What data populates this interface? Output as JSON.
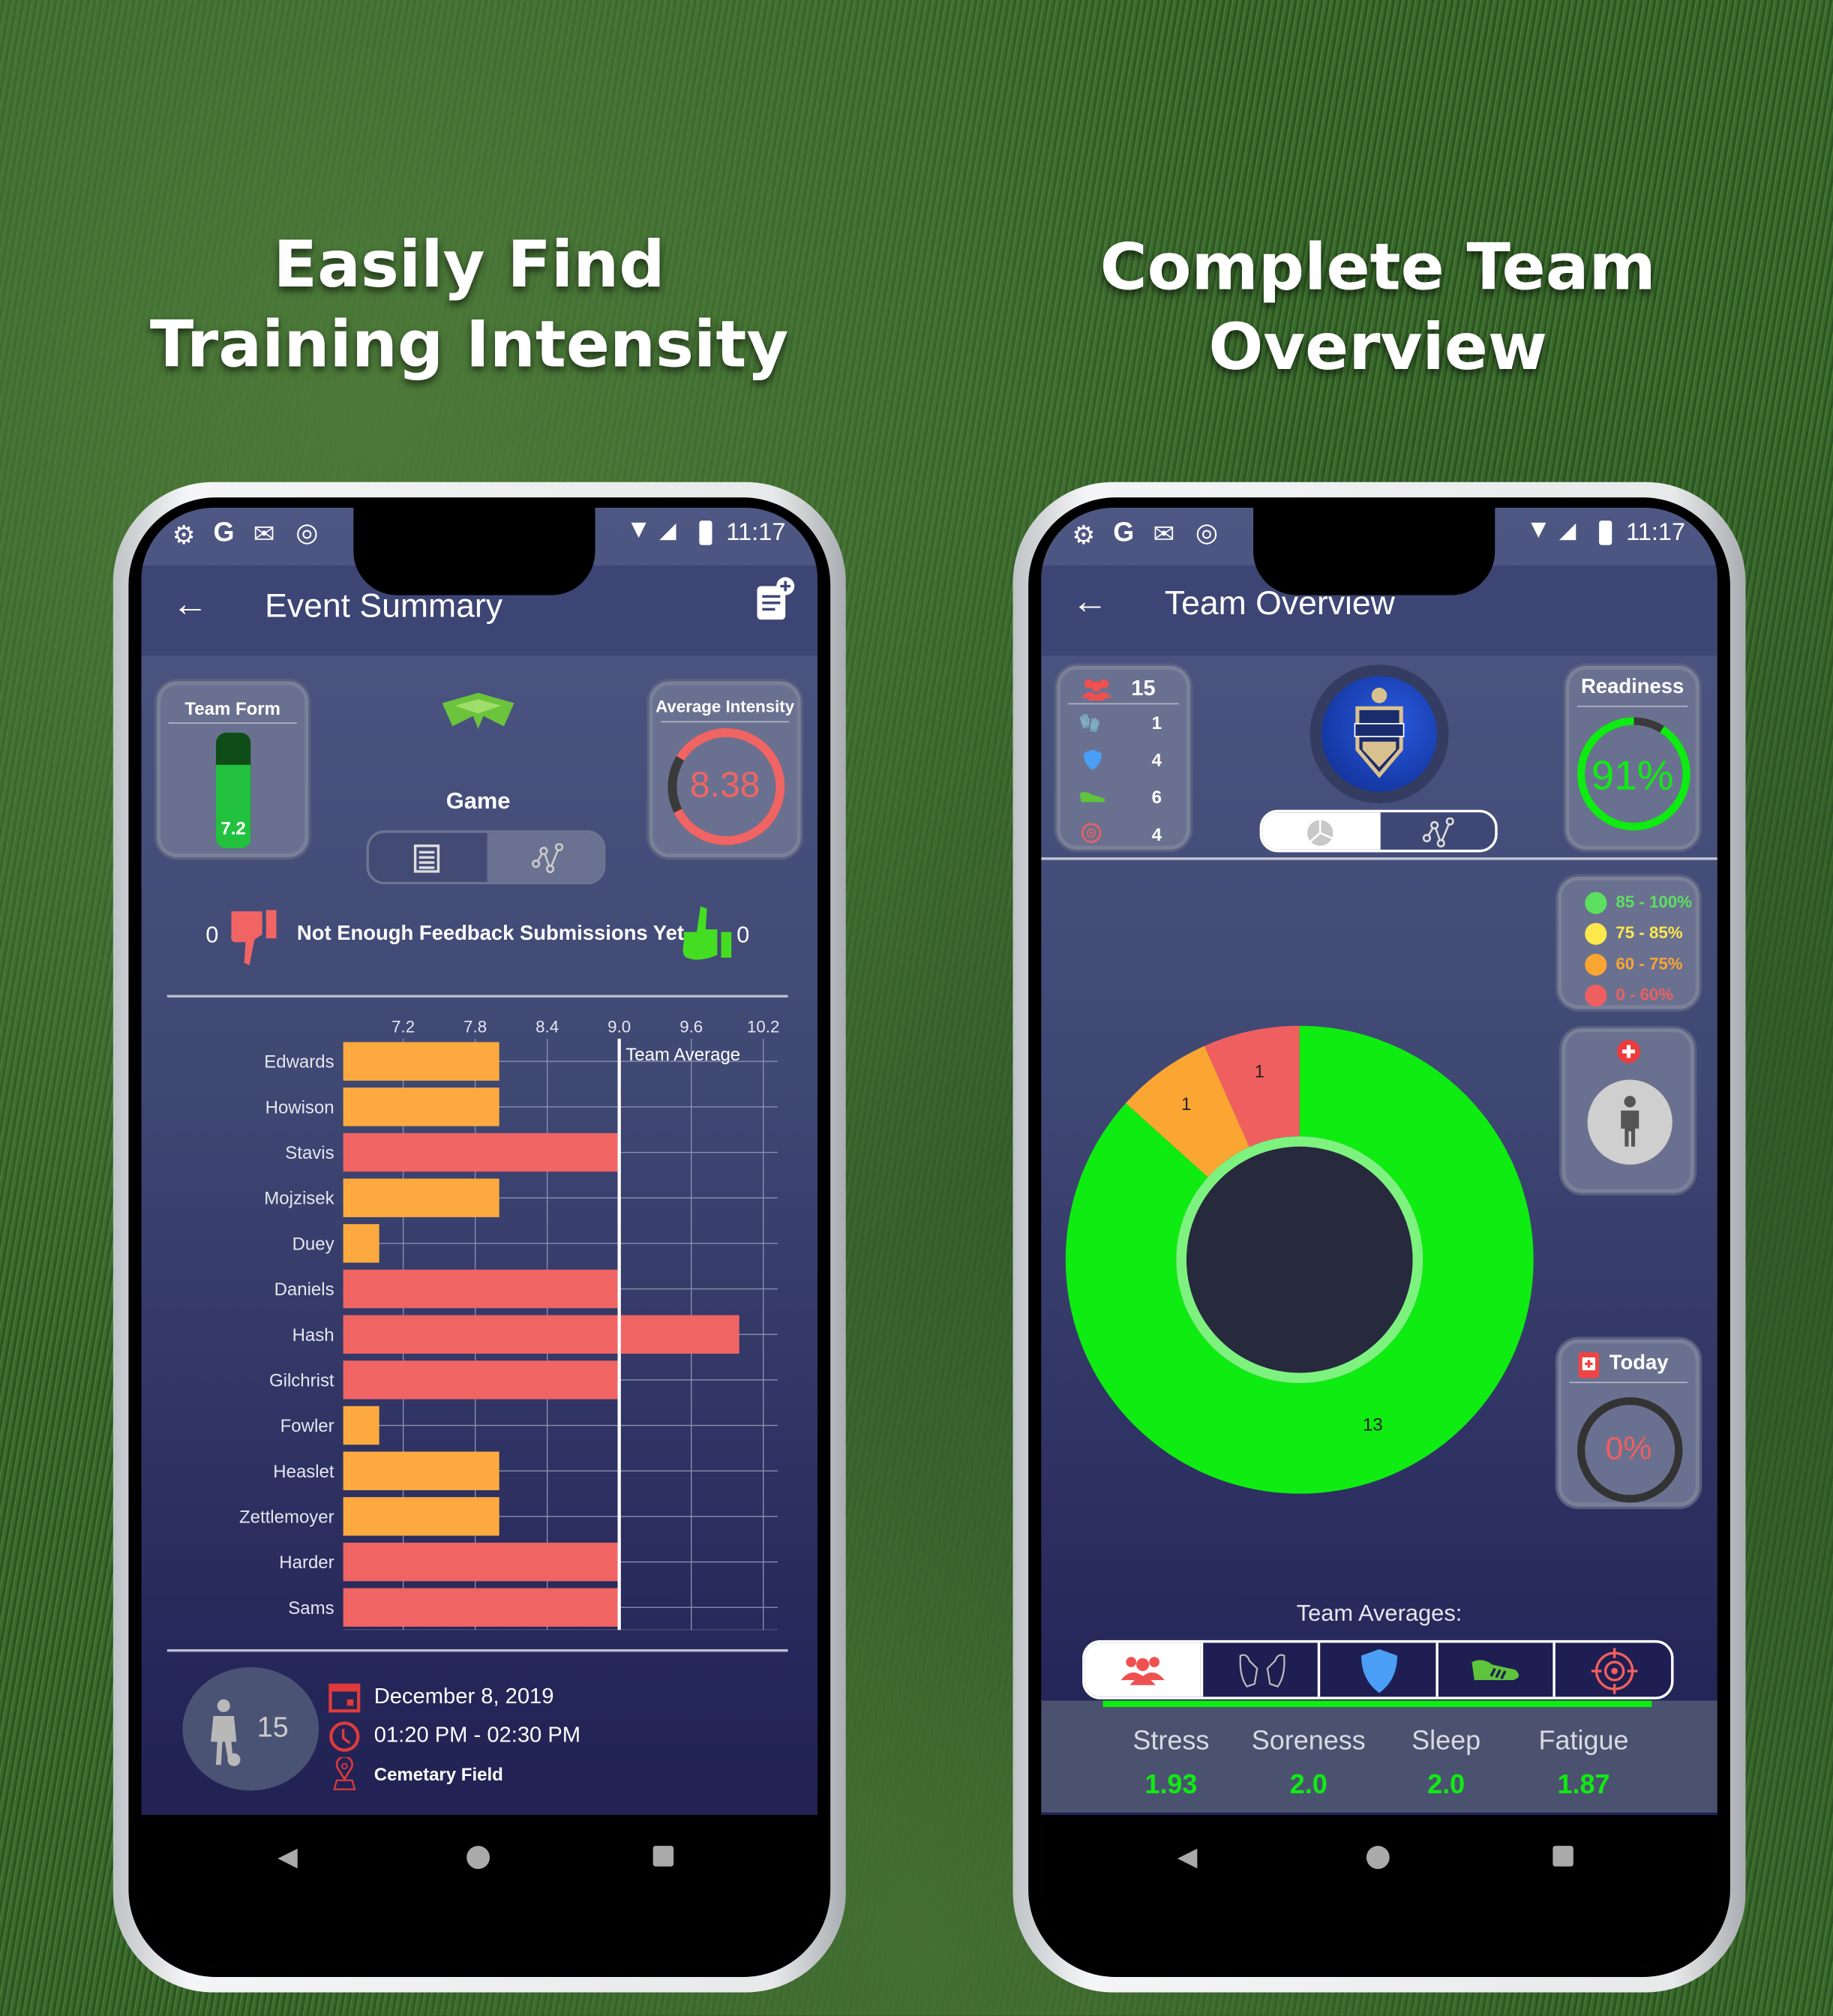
{
  "headlines": {
    "left": [
      "Easily Find",
      "Training Intensity"
    ],
    "right": [
      "Complete Team",
      "Overview"
    ]
  },
  "status": {
    "time": "11:17"
  },
  "event_summary": {
    "title": "Event Summary",
    "team_form": {
      "label": "Team Form",
      "value": "7.2",
      "fill_fraction": 0.72
    },
    "event_type": "Game",
    "average_intensity": {
      "label": "Average Intensity",
      "value": "8.38",
      "fill_fraction": 0.838
    },
    "feedback": {
      "thumbs_down": "0",
      "message": "Not Enough Feedback Submissions Yet",
      "thumbs_up": "0"
    },
    "players_count": "15",
    "date": "December 8, 2019",
    "time": "01:20 PM - 02:30 PM",
    "location": "Cemetary Field",
    "colors": {
      "orange": "#fcaa3f",
      "red": "#f06464",
      "green": "#22c23f"
    }
  },
  "chart_data": {
    "type": "bar",
    "orientation": "horizontal",
    "categories": [
      "Edwards",
      "Howison",
      "Stavis",
      "Mojzisek",
      "Duey",
      "Daniels",
      "Hash",
      "Gilchrist",
      "Fowler",
      "Heaslet",
      "Zettlemoyer",
      "Harder",
      "Sams"
    ],
    "values": [
      8,
      8,
      9,
      8,
      7,
      9,
      10,
      9,
      7,
      8,
      8,
      9,
      9
    ],
    "colors": [
      "#fcaa3f",
      "#fcaa3f",
      "#f06464",
      "#fcaa3f",
      "#fcaa3f",
      "#f06464",
      "#f06464",
      "#f06464",
      "#fcaa3f",
      "#fcaa3f",
      "#fcaa3f",
      "#f06464",
      "#f06464"
    ],
    "xticks": [
      "7.2",
      "7.8",
      "8.4",
      "9.0",
      "9.6",
      "10.2"
    ],
    "xlim": [
      6.7,
      10.32
    ],
    "reference_line": {
      "label": "Team Average",
      "value": 9.0
    },
    "grid": true
  },
  "team_overview": {
    "title": "Team Overview",
    "roster": {
      "total": "15",
      "rows": [
        {
          "icon": "goalkeeper-gloves-icon",
          "count": "1"
        },
        {
          "icon": "shield-icon",
          "count": "4"
        },
        {
          "icon": "cleat-icon",
          "count": "6"
        },
        {
          "icon": "target-icon",
          "count": "4"
        }
      ]
    },
    "readiness": {
      "label": "Readiness",
      "value": "91%",
      "fraction": 0.91
    },
    "legend": [
      {
        "label": "85 - 100%",
        "color": "#5de05f"
      },
      {
        "label": "75 - 85%",
        "color": "#fde84e"
      },
      {
        "label": "60 - 75%",
        "color": "#fba532"
      },
      {
        "label": "0 - 60%",
        "color": "#ef5f5f"
      }
    ],
    "donut": [
      {
        "label": "13",
        "value": 13,
        "color": "#0fec11"
      },
      {
        "label": "1",
        "value": 1,
        "color": "#ef5f5f"
      },
      {
        "label": "1",
        "value": 1,
        "color": "#fba532"
      }
    ],
    "today": {
      "label": "Today",
      "value": "0%"
    },
    "averages_title": "Team Averages:",
    "tabs": [
      "team-icon",
      "goalkeeper-gloves-icon",
      "shield-icon",
      "cleat-icon",
      "target-icon"
    ],
    "averages": [
      {
        "label": "Stress",
        "value": "1.93"
      },
      {
        "label": "Soreness",
        "value": "2.0"
      },
      {
        "label": "Sleep",
        "value": "2.0"
      },
      {
        "label": "Fatigue",
        "value": "1.87"
      }
    ]
  }
}
